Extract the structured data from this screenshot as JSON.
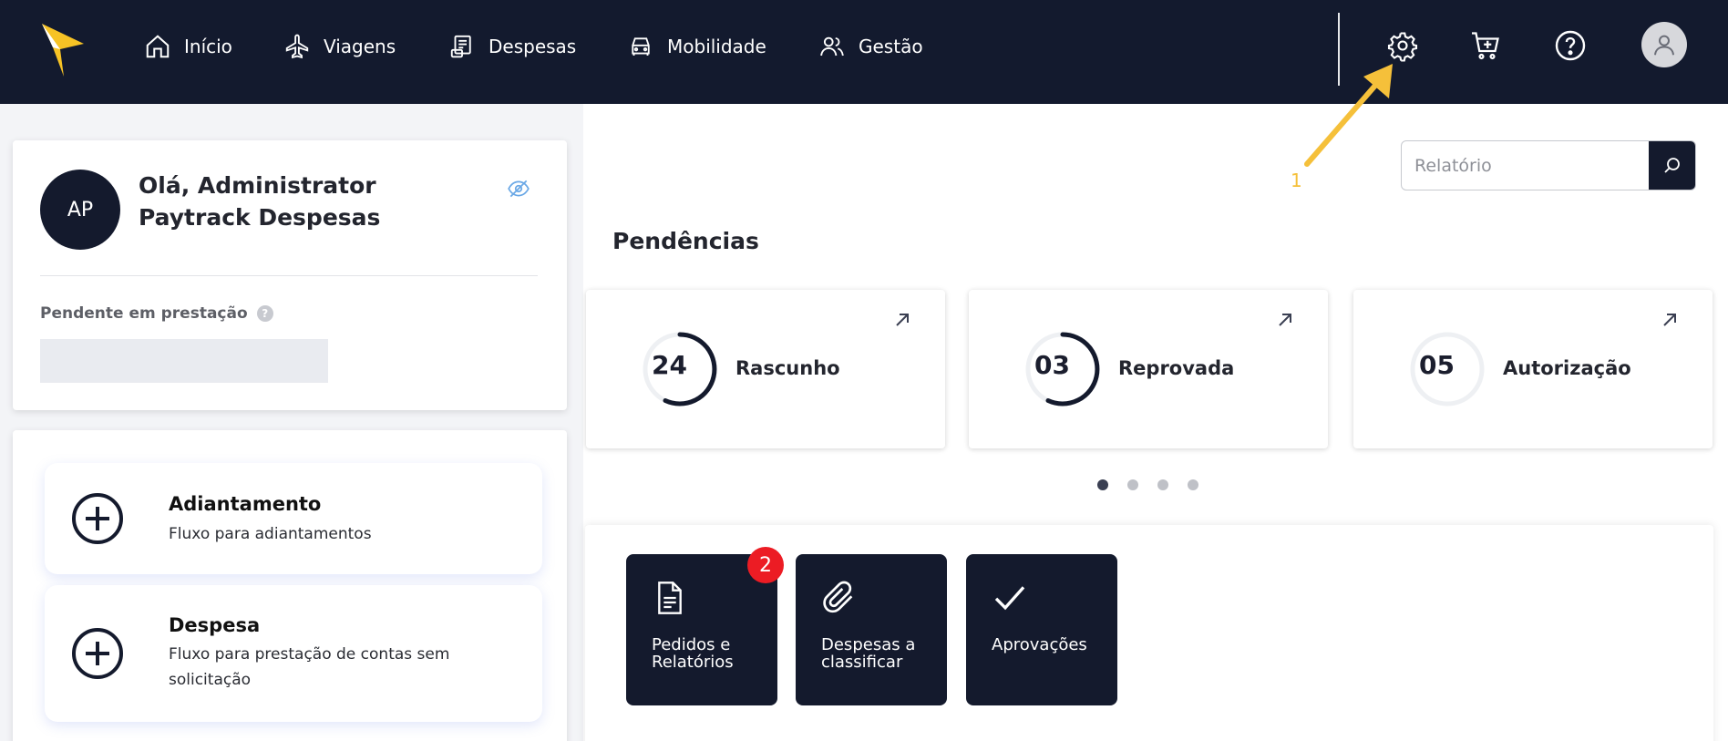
{
  "nav": {
    "items": [
      {
        "label": "Início"
      },
      {
        "label": "Viagens"
      },
      {
        "label": "Despesas"
      },
      {
        "label": "Mobilidade"
      },
      {
        "label": "Gestão"
      }
    ]
  },
  "profile": {
    "initials": "AP",
    "greeting": "Olá, Administrator Paytrack Despesas",
    "pending_label": "Pendente em prestação",
    "help": "?"
  },
  "actions": [
    {
      "title": "Adiantamento",
      "desc": "Fluxo para adiantamentos"
    },
    {
      "title": "Despesa",
      "desc": "Fluxo para prestação de contas sem solicitação"
    }
  ],
  "search": {
    "placeholder": "Relatório"
  },
  "annotation": {
    "number": "1"
  },
  "pendencias": {
    "title": "Pendências",
    "cards": [
      {
        "count": "24",
        "label": "Rascunho"
      },
      {
        "count": "03",
        "label": "Reprovada"
      },
      {
        "count": "05",
        "label": "Autorização"
      }
    ]
  },
  "tiles": [
    {
      "label": "Pedidos e Relatórios",
      "badge": "2"
    },
    {
      "label": "Despesas a classificar"
    },
    {
      "label": "Aprovações"
    }
  ],
  "colors": {
    "nav_bg": "#131a2e",
    "logo_yellow": "#f7c325",
    "badge_red": "#ec1c24",
    "annotation": "#f5c03a"
  }
}
